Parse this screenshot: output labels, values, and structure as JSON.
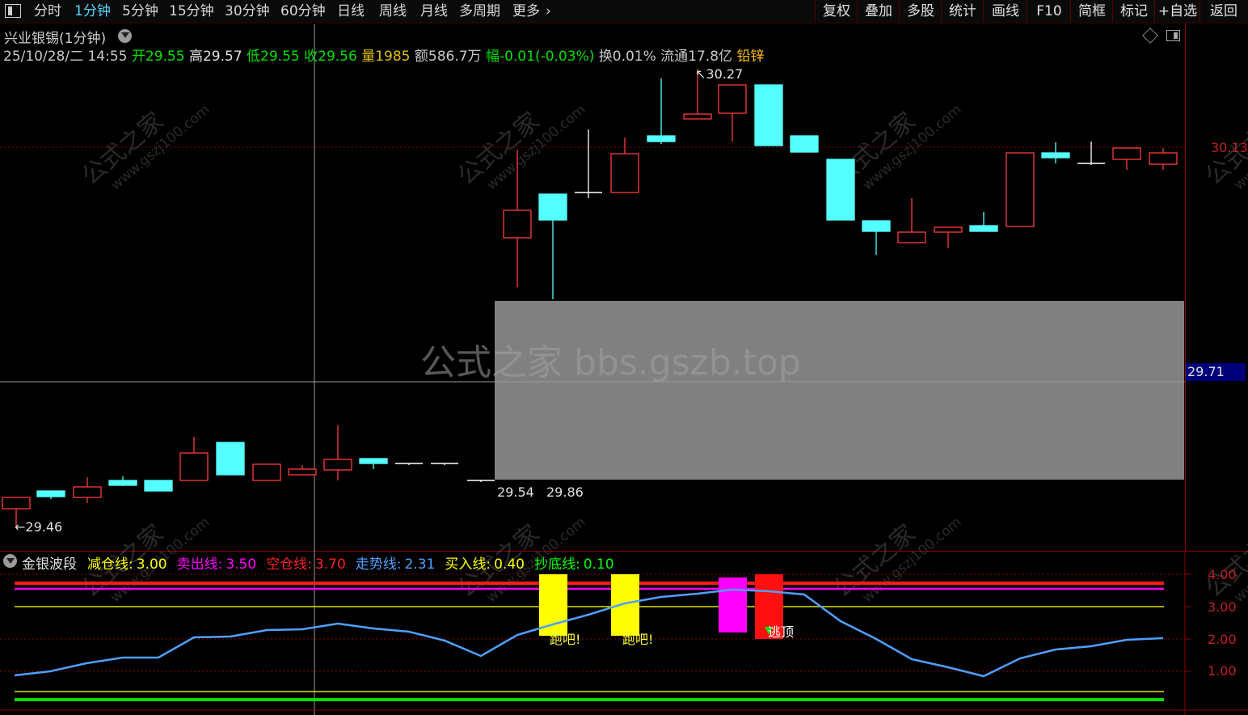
{
  "toolbar": {
    "periods": [
      {
        "label": "分时",
        "active": false
      },
      {
        "label": "1分钟",
        "active": true
      },
      {
        "label": "5分钟",
        "active": false
      },
      {
        "label": "15分钟",
        "active": false
      },
      {
        "label": "30分钟",
        "active": false
      },
      {
        "label": "60分钟",
        "active": false
      },
      {
        "label": "日线",
        "active": false
      },
      {
        "label": "周线",
        "active": false
      },
      {
        "label": "月线",
        "active": false
      },
      {
        "label": "多周期",
        "active": false
      },
      {
        "label": "更多",
        "active": false
      }
    ],
    "right_buttons": [
      "复权",
      "叠加",
      "多股",
      "统计",
      "画线",
      "F10",
      "简框",
      "标记",
      "+自选",
      "返回"
    ]
  },
  "stock": {
    "title": "兴业银锡(1分钟)",
    "datetime": "25/10/28/二 14:55",
    "open_label": "开",
    "open": "29.55",
    "high_label": "高",
    "high": "29.57",
    "low_label": "低",
    "low": "29.55",
    "close_label": "收",
    "close": "29.56",
    "vol_label": "量",
    "vol": "1985",
    "amount_label": "额",
    "amount": "586.7万",
    "change_label": "幅",
    "change": "-0.01(-0.03%)",
    "turnover_label": "换",
    "turnover": "0.01%",
    "float_label": "流通",
    "float": "17.8亿",
    "sector": "铅锌"
  },
  "main_chart": {
    "price_high_label": "30.27",
    "price_low_label": "29.46",
    "range_label_left": "29.54",
    "range_label_right": "29.86",
    "axis_right_label": "30.13",
    "crosshair_price": "29.71",
    "center_watermark": "公式之家 bbs.gszb.top",
    "watermark_cn": "公式之家",
    "watermark_url": "www.gszj100.com",
    "up_color": "#ff3b3b",
    "down_color": "#54ffff",
    "flat_color": "#ffffff"
  },
  "indicator": {
    "name": "金银波段",
    "params": [
      {
        "label": "减仓线:",
        "value": "3.00",
        "color": "#ffff00"
      },
      {
        "label": "卖出线:",
        "value": "3.50",
        "color": "#ff00ff"
      },
      {
        "label": "空仓线:",
        "value": "3.70",
        "color": "#ff2020"
      },
      {
        "label": "走势线:",
        "value": "2.31",
        "color": "#4fa0ff"
      },
      {
        "label": "买入线:",
        "value": "0.40",
        "color": "#ffff00"
      },
      {
        "label": "抄底线:",
        "value": "0.10",
        "color": "#00ff00"
      }
    ],
    "y_ticks": [
      "4.00",
      "3.00",
      "2.00",
      "1.00"
    ],
    "signals": [
      "跑吧!",
      "跑吧!",
      "逃顶"
    ]
  }
}
